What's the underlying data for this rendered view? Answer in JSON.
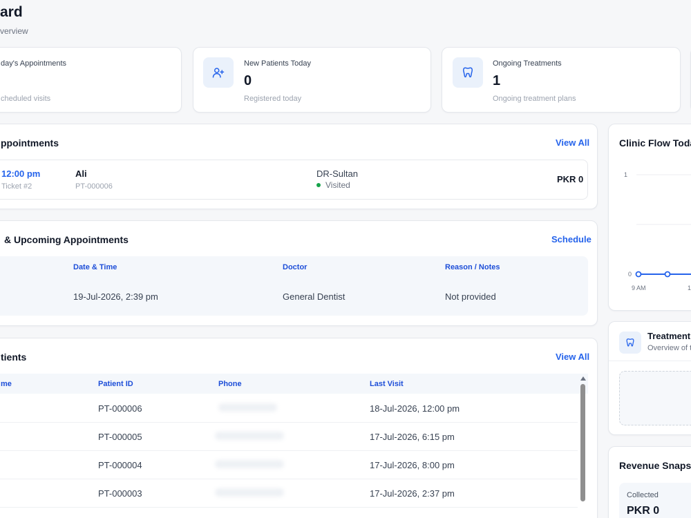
{
  "header": {
    "title": "ard",
    "subtitle": "verview"
  },
  "stats": [
    {
      "label": "day's Appointments",
      "value": "",
      "sub": "cheduled visits"
    },
    {
      "label": "New Patients Today",
      "value": "0",
      "sub": "Registered today",
      "icon": "user-plus-icon"
    },
    {
      "label": "Ongoing Treatments",
      "value": "1",
      "sub": "Ongoing treatment plans",
      "icon": "tooth-icon"
    }
  ],
  "today_appointments": {
    "title": "ppointments",
    "view_all": "View All",
    "item": {
      "time": "12:00 pm",
      "ticket": "Ticket #2",
      "name": "Ali",
      "patient_id": "PT-000006",
      "doctor": "DR-Sultan",
      "status": "Visited",
      "amount": "PKR 0"
    }
  },
  "upcoming": {
    "title": "& Upcoming Appointments",
    "action": "Schedule",
    "headers": [
      "Date & Time",
      "Doctor",
      "Reason / Notes"
    ],
    "rows": [
      {
        "datetime": "19-Jul-2026, 2:39 pm",
        "doctor": "General Dentist",
        "reason": "Not provided"
      }
    ]
  },
  "patients": {
    "title": "tients",
    "view_all": "View All",
    "headers": [
      "me",
      "Patient ID",
      "Phone",
      "Last Visit"
    ],
    "rows": [
      {
        "id": "PT-000006",
        "last_visit": "18-Jul-2026, 12:00 pm"
      },
      {
        "id": "PT-000005",
        "last_visit": "17-Jul-2026, 6:15 pm"
      },
      {
        "id": "PT-000004",
        "last_visit": "17-Jul-2026, 8:00 pm"
      },
      {
        "id": "PT-000003",
        "last_visit": "17-Jul-2026, 2:37 pm"
      }
    ]
  },
  "clinic_flow": {
    "title": "Clinic Flow Toda",
    "chart_data": {
      "type": "line",
      "x": [
        "9 AM",
        "1"
      ],
      "series": [
        {
          "values": [
            0,
            0,
            0
          ]
        }
      ],
      "yticks": [
        "1",
        "0"
      ],
      "ylim": [
        0,
        1
      ]
    }
  },
  "treatment": {
    "title": "Treatment",
    "sub": "Overview of t"
  },
  "revenue": {
    "title": "Revenue Snapsh",
    "collected_label": "Collected",
    "collected_value": "PKR 0"
  },
  "colors": {
    "accent": "#2563eb",
    "success": "#16a34a",
    "icon_bg": "#eaf1fb"
  }
}
